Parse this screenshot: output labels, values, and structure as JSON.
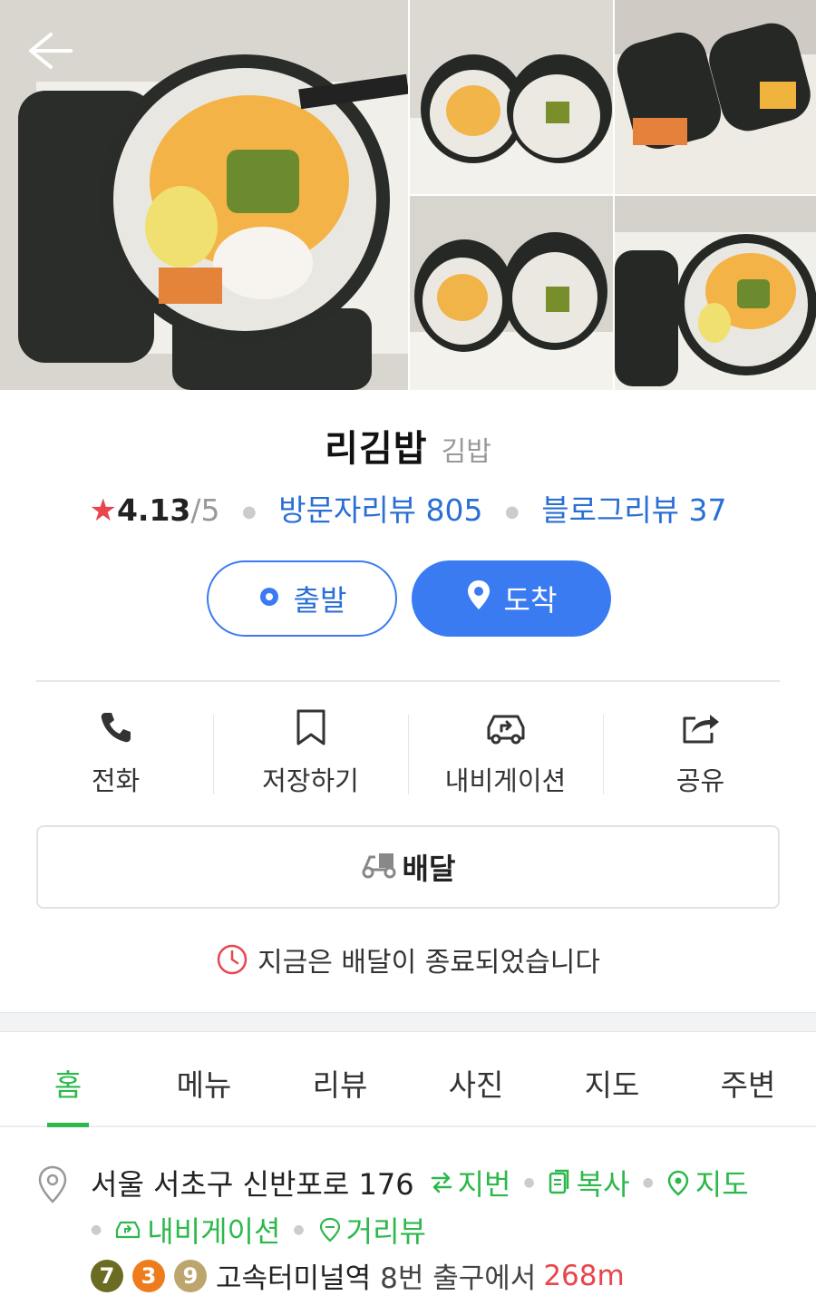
{
  "gallery": {
    "photo_count": 5
  },
  "place": {
    "name": "리김밥",
    "category": "김밥"
  },
  "rating": {
    "score": "4.13",
    "max": "/5",
    "visitor_reviews_label": "방문자리뷰 805",
    "blog_reviews_label": "블로그리뷰 37",
    "star_color": "#e8454d"
  },
  "route": {
    "depart_label": "출발",
    "arrive_label": "도착",
    "accent": "#3a7bf2"
  },
  "actions": [
    {
      "label": "전화",
      "icon": "phone-icon"
    },
    {
      "label": "저장하기",
      "icon": "bookmark-icon"
    },
    {
      "label": "내비게이션",
      "icon": "car-navigation-icon"
    },
    {
      "label": "공유",
      "icon": "share-icon"
    }
  ],
  "delivery": {
    "button_label": "배달",
    "status_text": "지금은 배달이 종료되었습니다"
  },
  "tabs": [
    {
      "label": "홈",
      "active": true
    },
    {
      "label": "메뉴",
      "active": false
    },
    {
      "label": "리뷰",
      "active": false
    },
    {
      "label": "사진",
      "active": false
    },
    {
      "label": "지도",
      "active": false
    },
    {
      "label": "주변",
      "active": false
    }
  ],
  "address": {
    "text": "서울 서초구 신반포로 176",
    "lot_number_label": "지번",
    "copy_label": "복사",
    "map_label": "지도",
    "navigation_label": "내비게이션",
    "street_view_label": "거리뷰",
    "accent": "#2db84c"
  },
  "subway": {
    "lines": [
      {
        "number": "7",
        "color": "#6b6c22"
      },
      {
        "number": "3",
        "color": "#ef7c1c"
      },
      {
        "number": "9",
        "color": "#bda56e"
      }
    ],
    "station": "고속터미널역",
    "exit": "8번 출구에서",
    "distance": "268m"
  }
}
